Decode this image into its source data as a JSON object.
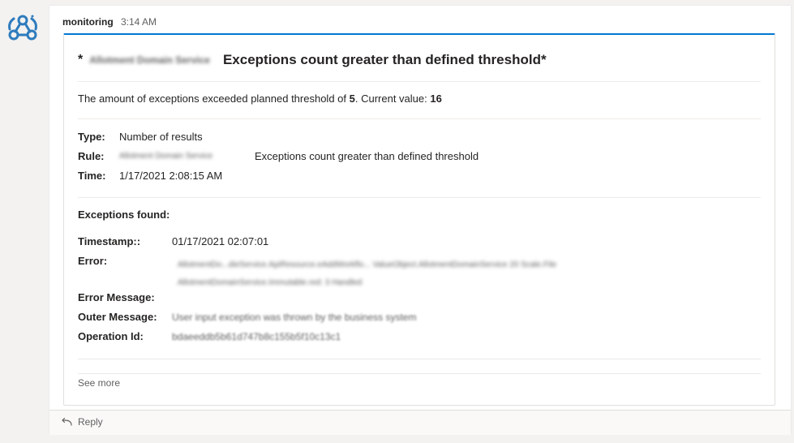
{
  "message": {
    "sender": "monitoring",
    "time": "3:14 AM"
  },
  "card": {
    "title_prefix": "*",
    "title_blurred": "Allotment Domain Service",
    "title": "Exceptions count greater than defined threshold*",
    "summary": {
      "text_before": "The amount of exceptions exceeded planned threshold of ",
      "threshold": "5",
      "text_middle": ". Current value: ",
      "current_value": "16"
    },
    "details": {
      "type_label": "Type:",
      "type_value": "Number of results",
      "rule_label": "Rule:",
      "rule_blurred": "Allotment Domain Service",
      "rule_value": "Exceptions count greater than defined threshold",
      "time_label": "Time:",
      "time_value": "1/17/2021 2:08:15 AM"
    },
    "exceptions": {
      "heading": "Exceptions found:",
      "timestamp_label": "Timestamp::",
      "timestamp_value": "01/17/2021 02:07:01",
      "error_label": "Error:",
      "error_line1": "AllotmentDo...dieService.ApiResource.eAddWorkflo... ValueObject.AllotmentDomainService 20 Scale.File",
      "error_line2": "AllotmentDomainService.Immutable.red: 3 Handled",
      "error_message_label": "Error Message:",
      "outer_message_label": "Outer Message:",
      "outer_message_value": "User input exception was thrown by the business system",
      "operation_label": "Operation Id:",
      "operation_value": "bdaeeddb5b61d747b8c155b5f10c13c1"
    },
    "see_more": "See more"
  },
  "reply": {
    "label": "Reply"
  },
  "colors": {
    "accent": "#0078d4",
    "avatar": "#2e7bbd"
  }
}
